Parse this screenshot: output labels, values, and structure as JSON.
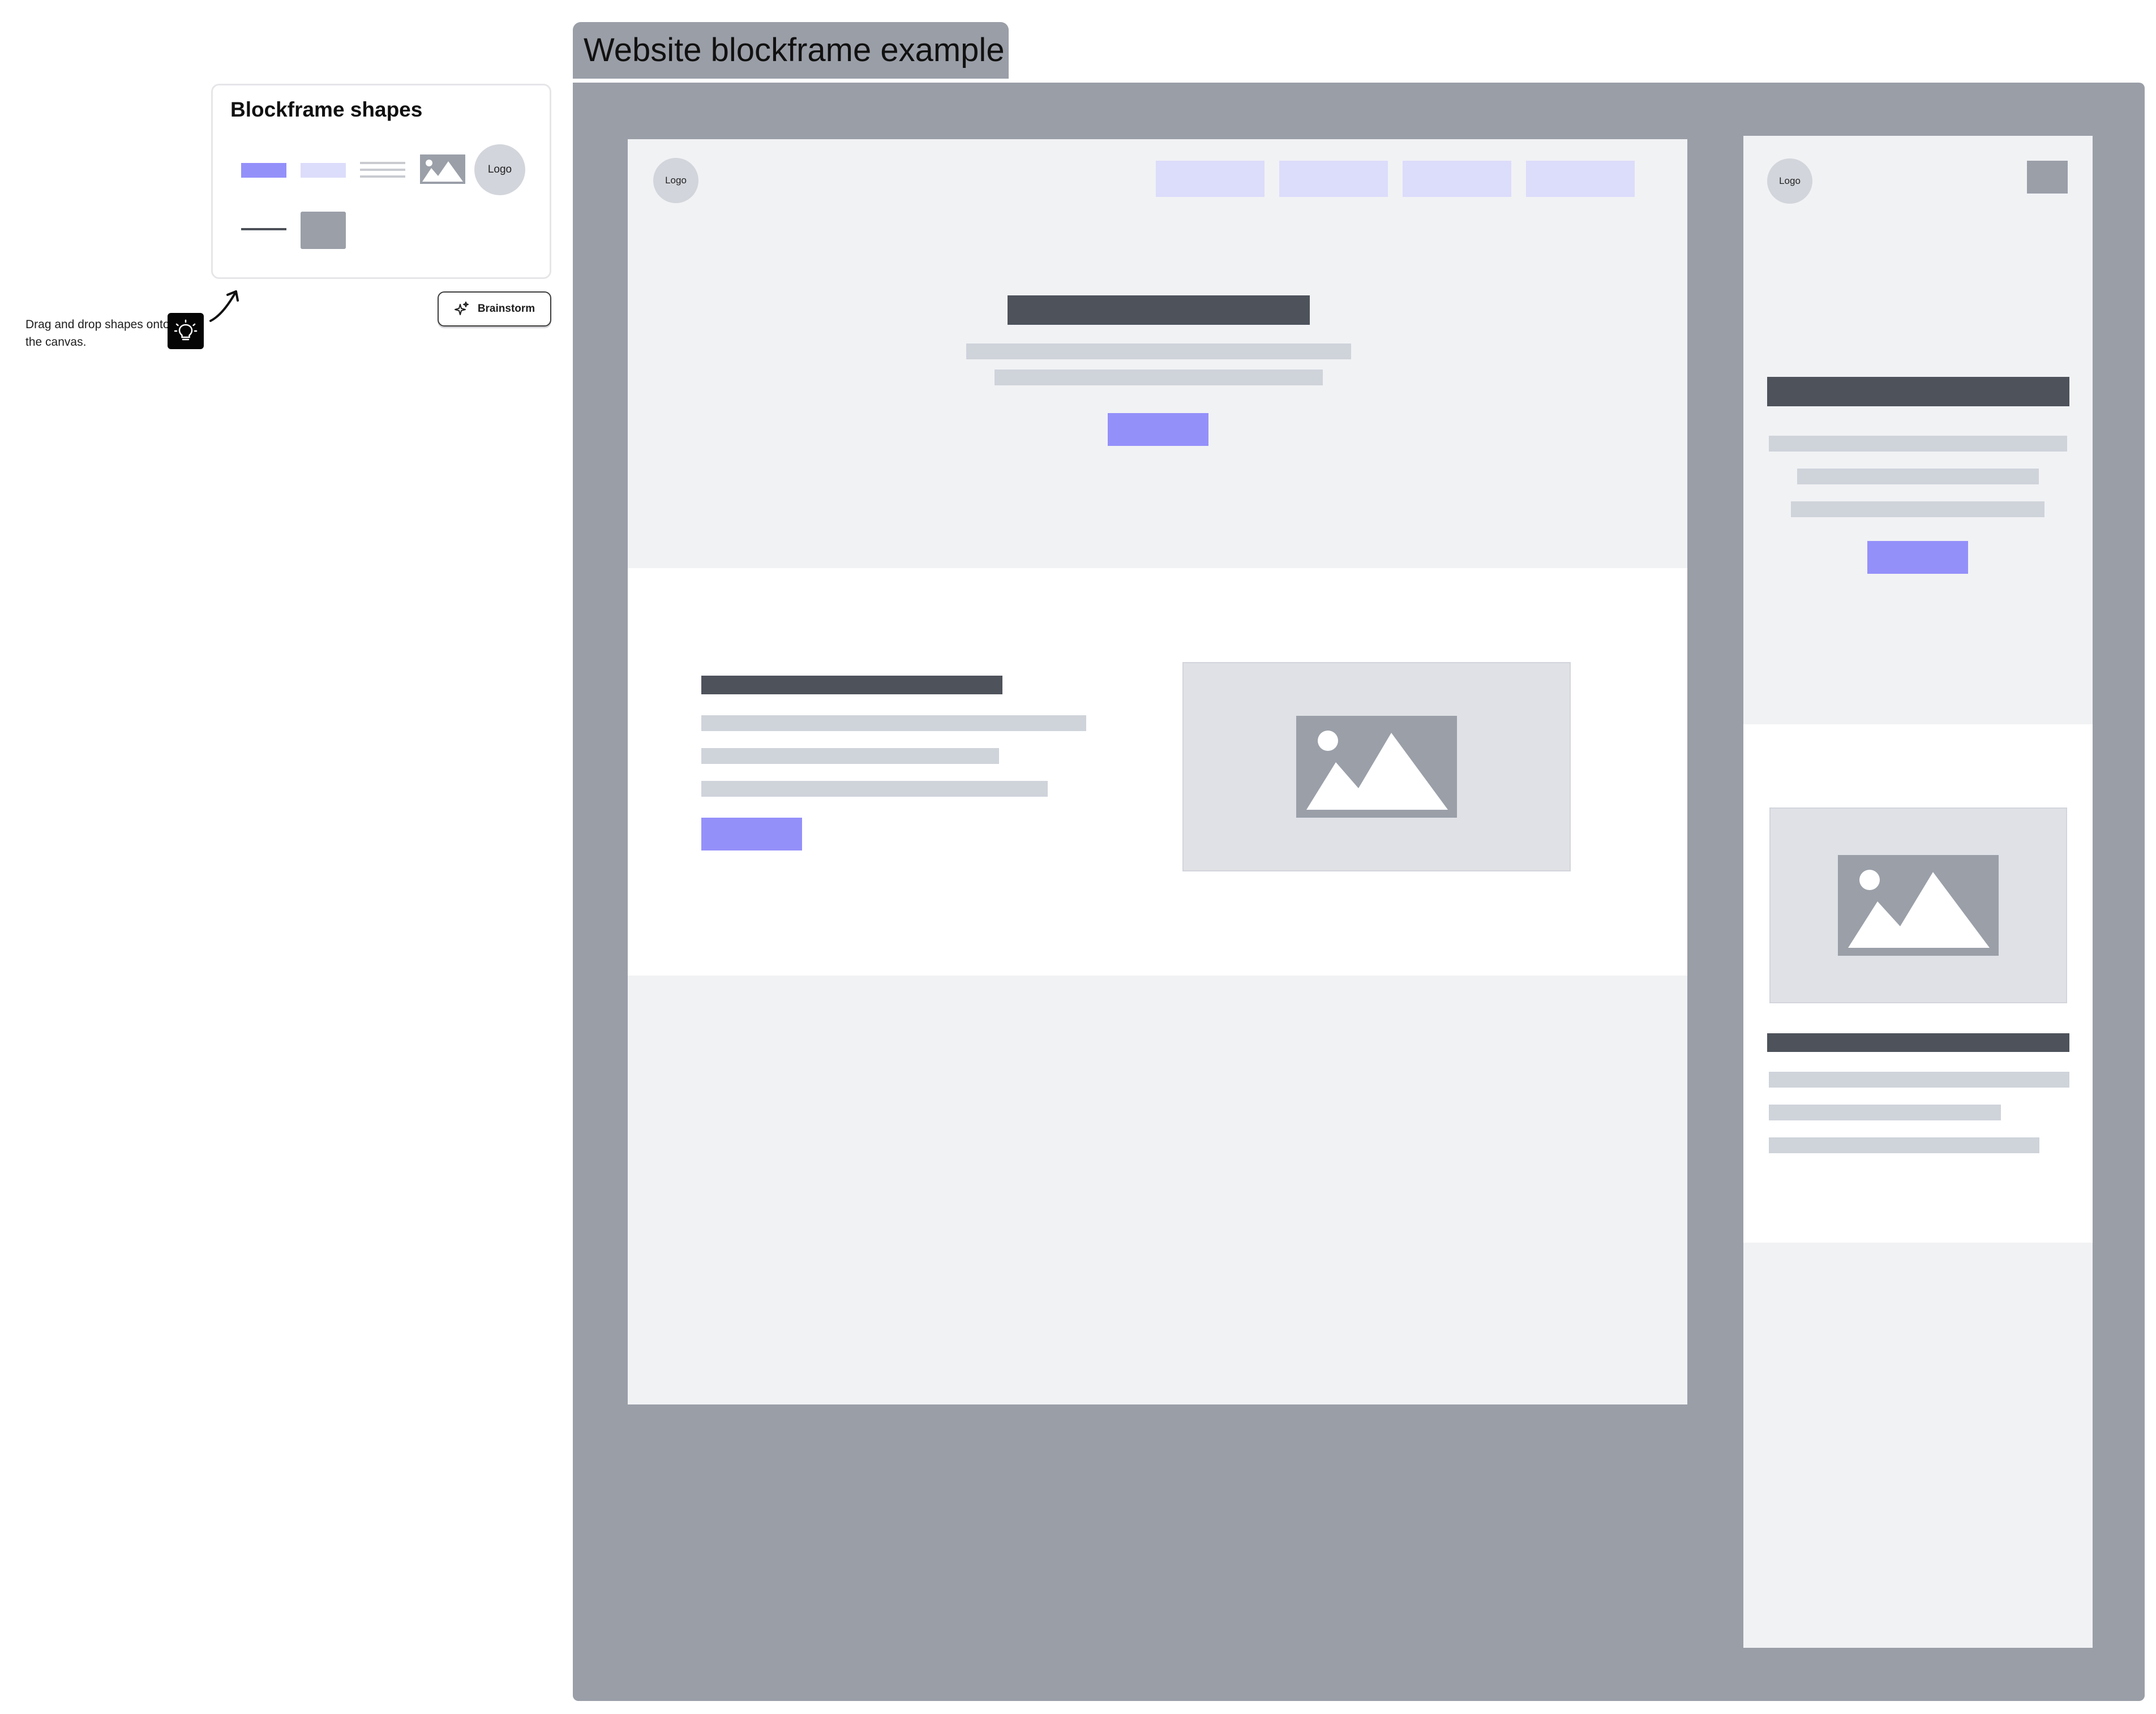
{
  "palette": {
    "title": "Blockframe shapes",
    "logo_label": "Logo"
  },
  "hint": {
    "text": "Drag and drop shapes onto the canvas."
  },
  "brainstorm": {
    "label": "Brainstorm"
  },
  "frame": {
    "title": "Website blockframe example"
  },
  "desktop": {
    "logo_label": "Logo"
  },
  "mobile": {
    "logo_label": "Logo"
  },
  "colors": {
    "frame": "#9a9ea7",
    "accent": "#9490fa",
    "accent_light": "#dcdcfb",
    "dark_bar": "#4d525b",
    "light_bar": "#cfd3da",
    "wireframe_bg": "#f1f2f4"
  },
  "icons": {
    "bulb": "lightbulb-icon",
    "sparkle": "sparkle-icon",
    "arrow": "curved-arrow-icon",
    "image": "image-placeholder-icon"
  }
}
